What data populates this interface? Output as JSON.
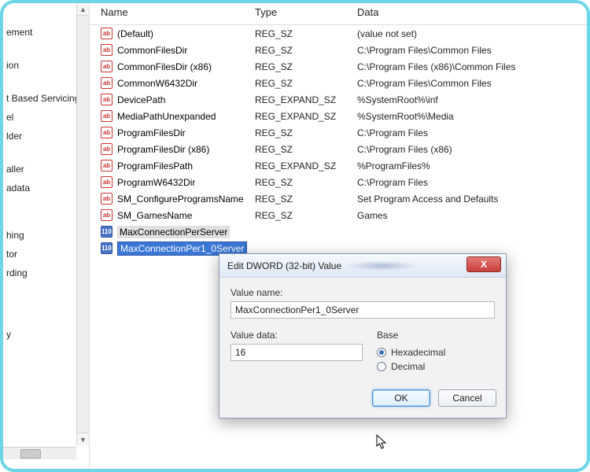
{
  "tree": {
    "items": [
      "ement",
      "",
      "ion",
      "",
      "t Based Servicing",
      "el",
      "lder",
      "",
      "aller",
      "adata",
      "",
      "",
      "hing",
      "tor",
      "rding",
      "",
      "",
      "",
      "y"
    ]
  },
  "columns": {
    "name": "Name",
    "type": "Type",
    "data": "Data"
  },
  "icons": {
    "sz": "ab",
    "bin": "110"
  },
  "rows": [
    {
      "icon": "sz",
      "name": "(Default)",
      "type": "REG_SZ",
      "data": "(value not set)"
    },
    {
      "icon": "sz",
      "name": "CommonFilesDir",
      "type": "REG_SZ",
      "data": "C:\\Program Files\\Common Files"
    },
    {
      "icon": "sz",
      "name": "CommonFilesDir (x86)",
      "type": "REG_SZ",
      "data": "C:\\Program Files (x86)\\Common Files"
    },
    {
      "icon": "sz",
      "name": "CommonW6432Dir",
      "type": "REG_SZ",
      "data": "C:\\Program Files\\Common Files"
    },
    {
      "icon": "sz",
      "name": "DevicePath",
      "type": "REG_EXPAND_SZ",
      "data": "%SystemRoot%\\inf"
    },
    {
      "icon": "sz",
      "name": "MediaPathUnexpanded",
      "type": "REG_EXPAND_SZ",
      "data": "%SystemRoot%\\Media"
    },
    {
      "icon": "sz",
      "name": "ProgramFilesDir",
      "type": "REG_SZ",
      "data": "C:\\Program Files"
    },
    {
      "icon": "sz",
      "name": "ProgramFilesDir (x86)",
      "type": "REG_SZ",
      "data": "C:\\Program Files (x86)"
    },
    {
      "icon": "sz",
      "name": "ProgramFilesPath",
      "type": "REG_EXPAND_SZ",
      "data": "%ProgramFiles%"
    },
    {
      "icon": "sz",
      "name": "ProgramW6432Dir",
      "type": "REG_SZ",
      "data": "C:\\Program Files"
    },
    {
      "icon": "sz",
      "name": "SM_ConfigureProgramsName",
      "type": "REG_SZ",
      "data": "Set Program Access and Defaults"
    },
    {
      "icon": "sz",
      "name": "SM_GamesName",
      "type": "REG_SZ",
      "data": "Games"
    },
    {
      "icon": "bin",
      "name": "MaxConnectionPerServer",
      "type": "",
      "data": "",
      "highlight": true
    },
    {
      "icon": "bin",
      "name": "MaxConnectionPer1_0Server",
      "type": "",
      "data": "",
      "selected": true
    }
  ],
  "dialog": {
    "title": "Edit DWORD (32-bit) Value",
    "value_name_label": "Value name:",
    "value_name": "MaxConnectionPer1_0Server",
    "value_data_label": "Value data:",
    "value_data": "16",
    "base_label": "Base",
    "hex_label": "Hexadecimal",
    "dec_label": "Decimal",
    "base_selected": "hex",
    "ok": "OK",
    "cancel": "Cancel",
    "close_glyph": "X"
  }
}
